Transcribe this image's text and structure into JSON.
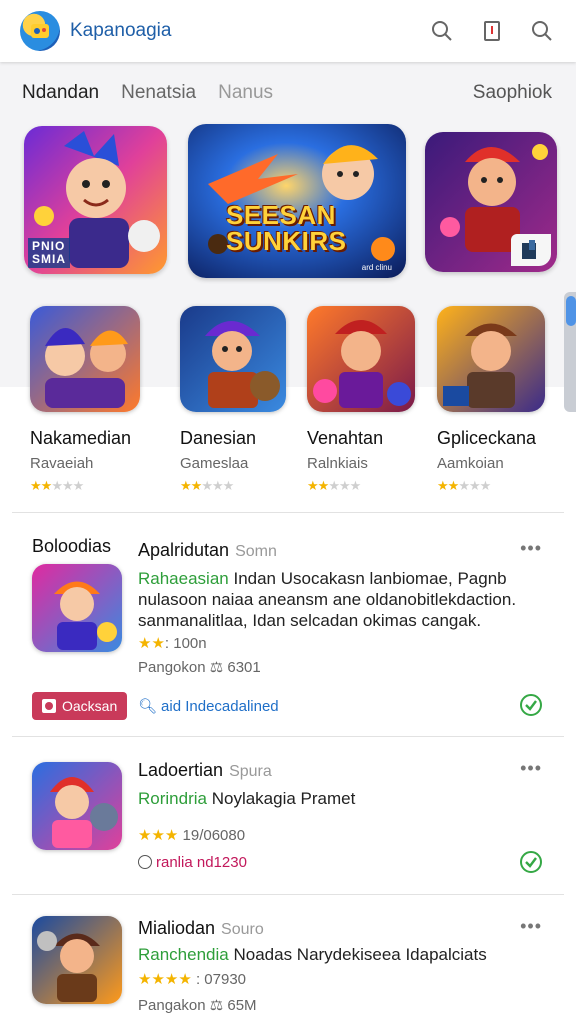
{
  "header": {
    "title": "Kapanoagia",
    "icons": [
      "search-icon",
      "bookmark-icon",
      "search-icon"
    ]
  },
  "tabs": [
    {
      "label": "Ndandan"
    },
    {
      "label": "Nenatsia"
    },
    {
      "label": "Nanus"
    },
    {
      "label": "Saophiok"
    }
  ],
  "featured": [
    {
      "badge_line1": "PNIO",
      "badge_line2": "SMIA"
    },
    {
      "title_line1": "SEESAN",
      "title_line2": "SUNKIRS",
      "caption": "ard clinu"
    },
    {
      "corner_icon": "app-icon"
    }
  ],
  "games": [
    {
      "name": "Nakamedian",
      "developer": "Ravaeiah",
      "stars": 2
    },
    {
      "name": "Danesian",
      "developer": "Gameslaa",
      "stars": 2
    },
    {
      "name": "Venahtan",
      "developer": "Ralnkiais",
      "stars": 2
    },
    {
      "name": "Gpliceckana",
      "developer": "Aamkoian",
      "stars": 2
    }
  ],
  "list": [
    {
      "section": "Boloodias",
      "title": "Apalridutan",
      "source": "Somn",
      "desc_green": "Rahaeasian",
      "desc_rest": " Indan Usocakasn lanbiomae, Pagnb nulasoon naiaa aneansm ane oldanobitlekdaction. sanmanalitlaa, Idan selcadan okimas cangak.",
      "rating_stars": "★★",
      "rating_text": ": 100n",
      "meta_label": "Pangokon",
      "meta_value": "6301",
      "button_label": "Oacksan",
      "link_label": "aid Indecadalined"
    },
    {
      "title": "Ladoertian",
      "source": "Spura",
      "desc_green": "Rorindria",
      "desc_rest": " Noylakagia Pramet",
      "rating_stars": "★★★",
      "rating_text": " 19/06080",
      "meta_pink": "ranlia nd1230"
    },
    {
      "title": "Mialiodan",
      "source": "Souro",
      "desc_green": "Ranchendia",
      "desc_rest": " Noadas Narydekiseea Idapalciats",
      "rating_stars": "★★★★",
      "rating_text": " : 07930",
      "meta_label": "Pangakon",
      "meta_value": "65M"
    }
  ],
  "colors": {
    "accent": "#1f5fa8",
    "green": "#2e9e3a",
    "star": "#f4b400",
    "button": "#c93a5a"
  }
}
